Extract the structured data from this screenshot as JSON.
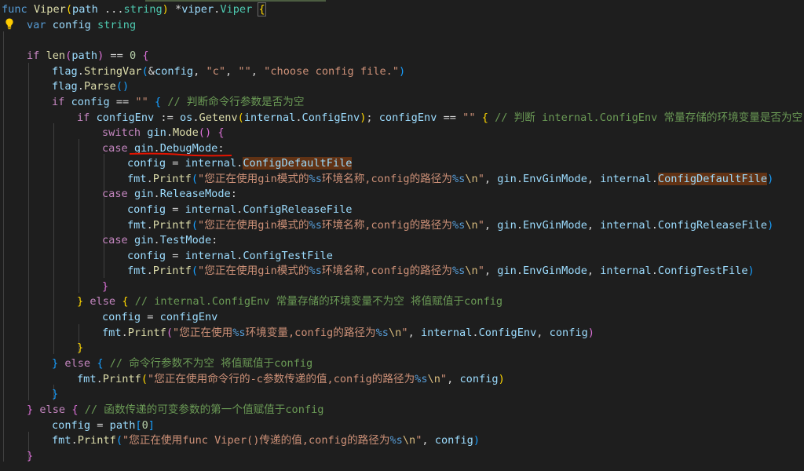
{
  "window": {
    "language": "Go",
    "theme_colors": {
      "background": "#1e1e1e",
      "keyword": "#569cd6",
      "control": "#c586c0",
      "function": "#dcdcaa",
      "variable": "#9cdcfe",
      "type": "#4ec9b0",
      "string": "#ce9178",
      "number": "#b5cea8",
      "comment": "#6a9955",
      "highlight": "#613214",
      "annotation": "#e51400"
    }
  },
  "code": {
    "l1": {
      "kw": "func",
      "name": "Viper",
      "p_open": "(",
      "param": "path",
      "variadic": " ...",
      "ptype": "string",
      "p_close": ")",
      "ret_star": " *",
      "ret_pkg": "viper",
      "ret_dot": ".",
      "ret_type": "Viper",
      "sp": " ",
      "brace": "{"
    },
    "l2": {
      "kw": "var",
      "name": "config",
      "type": "string"
    },
    "l4": {
      "kw": "if",
      "fn": "len",
      "arg": "path",
      "op": " == ",
      "num": "0",
      "brace": " {"
    },
    "l5": {
      "pkg": "flag",
      "fn": "StringVar",
      "amp": "&",
      "arg1": "config",
      "s1": "\"c\"",
      "s2": "\"\"",
      "s3": "\"choose config file.\""
    },
    "l6": {
      "pkg": "flag",
      "fn": "Parse"
    },
    "l7": {
      "kw": "if",
      "var": "config",
      "op": " == ",
      "str": "\"\"",
      "cm": "// 判断命令行参数是否为空"
    },
    "l8": {
      "kw": "if",
      "var": "configEnv",
      "op": " := ",
      "pkg": "os",
      "fn": "Getenv",
      "apkg": "internal",
      "afield": "ConfigEnv",
      "var2": "configEnv",
      "str": "\"\"",
      "cm": "// 判断 internal.ConfigEnv 常量存储的环境变量是否为空"
    },
    "l9": {
      "kw": "switch",
      "pkg": "gin",
      "fn": "Mode"
    },
    "l10": {
      "kw": "case",
      "pkg": "gin",
      "field": "DebugMode"
    },
    "l11": {
      "var": "config",
      "pkg": "internal",
      "field": "ConfigDefaultFile"
    },
    "l12": {
      "pkg": "fmt",
      "fn": "Printf",
      "str_a": "\"您正在使用gin模式的",
      "fmt": "%s",
      "str_b": "环境名称,config的路径为",
      "fmt2": "%s",
      "esc": "\\n",
      "str_c": "\"",
      "a1pkg": "gin",
      "a1": "EnvGinMode",
      "a2pkg": "internal",
      "a2": "ConfigDefaultFile"
    },
    "l13": {
      "kw": "case",
      "pkg": "gin",
      "field": "ReleaseMode"
    },
    "l14": {
      "var": "config",
      "pkg": "internal",
      "field": "ConfigReleaseFile"
    },
    "l15": {
      "pkg": "fmt",
      "fn": "Printf",
      "a1pkg": "gin",
      "a1": "EnvGinMode",
      "a2pkg": "internal",
      "a2": "ConfigReleaseFile"
    },
    "l16": {
      "kw": "case",
      "pkg": "gin",
      "field": "TestMode"
    },
    "l17": {
      "var": "config",
      "pkg": "internal",
      "field": "ConfigTestFile"
    },
    "l18": {
      "pkg": "fmt",
      "fn": "Printf",
      "a1pkg": "gin",
      "a1": "EnvGinMode",
      "a2pkg": "internal",
      "a2": "ConfigTestFile"
    },
    "l20": {
      "kw": "else",
      "cm": "// internal.ConfigEnv 常量存储的环境变量不为空 将值赋值于config"
    },
    "l21": {
      "var": "config",
      "val": "configEnv"
    },
    "l22": {
      "pkg": "fmt",
      "fn": "Printf",
      "str_a": "\"您正在使用",
      "fmt": "%s",
      "str_b": "环境变量,config的路径为",
      "fmt2": "%s",
      "esc": "\\n",
      "str_c": "\"",
      "a1pkg": "internal",
      "a1": "ConfigEnv",
      "a2": "config"
    },
    "l24": {
      "kw": "else",
      "cm": "// 命令行参数不为空 将值赋值于config"
    },
    "l25": {
      "pkg": "fmt",
      "fn": "Printf",
      "str_a": "\"您正在使用命令行的-c参数传递的值,config的路径为",
      "fmt": "%s",
      "esc": "\\n",
      "str_c": "\"",
      "a1": "config"
    },
    "l27": {
      "kw": "else",
      "cm": "// 函数传递的可变参数的第一个值赋值于config"
    },
    "l28": {
      "var": "config",
      "arr": "path",
      "idx": "0"
    },
    "l29": {
      "pkg": "fmt",
      "fn": "Printf",
      "str_a": "\"您正在使用func Viper()传递的值,config的路径为",
      "fmt": "%s",
      "esc": "\\n",
      "str_c": "\"",
      "a1": "config"
    }
  }
}
